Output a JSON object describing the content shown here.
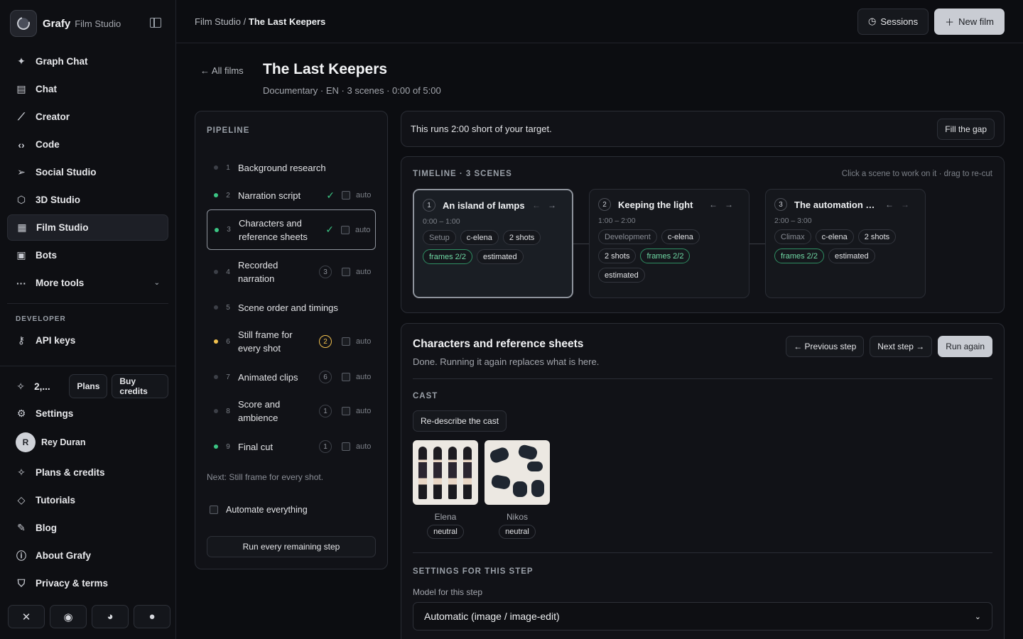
{
  "brand": {
    "name": "Grafy",
    "sub": "Film Studio"
  },
  "nav": [
    {
      "label": "Graph Chat",
      "icon": "sparkle-icon"
    },
    {
      "label": "Chat",
      "icon": "chat-icon"
    },
    {
      "label": "Creator",
      "icon": "wand-icon"
    },
    {
      "label": "Code",
      "icon": "code-icon"
    },
    {
      "label": "Social Studio",
      "icon": "send-icon"
    },
    {
      "label": "3D Studio",
      "icon": "cube-icon"
    },
    {
      "label": "Film Studio",
      "icon": "film-icon"
    },
    {
      "label": "Bots",
      "icon": "bot-icon"
    },
    {
      "label": "More tools",
      "icon": "more-icon"
    }
  ],
  "developer": {
    "label": "DEVELOPER",
    "api_keys": "API keys"
  },
  "credits": {
    "value": "2,...",
    "plans": "Plans",
    "buy": "Buy credits"
  },
  "bottom_nav": {
    "settings": "Settings",
    "user": "Rey Duran",
    "user_initial": "R",
    "plans_credits": "Plans & credits",
    "tutorials": "Tutorials",
    "blog": "Blog",
    "about": "About Grafy",
    "privacy": "Privacy & terms"
  },
  "topbar": {
    "crumb_root": "Film Studio",
    "crumb_sep": " / ",
    "crumb_current": "The Last Keepers",
    "sessions": "Sessions",
    "new_film": "New film"
  },
  "film": {
    "back": "← All films",
    "title": "The Last Keepers",
    "meta": "Documentary · EN · 3 scenes · 0:00 of 5:00"
  },
  "pipeline": {
    "label": "PIPELINE",
    "steps": [
      {
        "num": "1",
        "label": "Background research",
        "status": "none"
      },
      {
        "num": "2",
        "label": "Narration script",
        "status": "done",
        "auto": "auto"
      },
      {
        "num": "3",
        "label": "Characters and reference sheets",
        "status": "done",
        "auto": "auto"
      },
      {
        "num": "4",
        "label": "Recorded narration",
        "count": "3",
        "auto": "auto"
      },
      {
        "num": "5",
        "label": "Scene order and timings"
      },
      {
        "num": "6",
        "label": "Still frame for every shot",
        "count": "2",
        "auto": "auto"
      },
      {
        "num": "7",
        "label": "Animated clips",
        "count": "6",
        "auto": "auto"
      },
      {
        "num": "8",
        "label": "Score and ambience",
        "count": "1",
        "auto": "auto"
      },
      {
        "num": "9",
        "label": "Final cut",
        "count": "1",
        "auto": "auto"
      }
    ],
    "next_note": "Next: Still frame for every shot.",
    "automate": "Automate everything",
    "run_all": "Run every remaining step"
  },
  "alert": {
    "text": "This runs 2:00 short of your target.",
    "action": "Fill the gap"
  },
  "timeline": {
    "label": "TIMELINE · 3 SCENES",
    "hint": "Click a scene to work on it · drag to re-cut",
    "scenes": [
      {
        "num": "1",
        "title": "An island of lamps",
        "time": "0:00 – 1:00",
        "tags": [
          "Setup",
          "c-elena",
          "2 shots",
          "frames 2/2",
          "estimated"
        ]
      },
      {
        "num": "2",
        "title": "Keeping the light",
        "time": "1:00 – 2:00",
        "tags": [
          "Development",
          "c-elena",
          "2 shots",
          "frames 2/2",
          "estimated"
        ]
      },
      {
        "num": "3",
        "title": "The automation o...",
        "time": "2:00 – 3:00",
        "tags": [
          "Climax",
          "c-elena",
          "2 shots",
          "frames 2/2",
          "estimated"
        ]
      }
    ]
  },
  "detail": {
    "title": "Characters and reference sheets",
    "subtitle": "Done. Running it again replaces what is here.",
    "prev": "← Previous step",
    "next": "Next step →",
    "run_again": "Run again",
    "cast_label": "CAST",
    "redescribe": "Re-describe the cast",
    "cast": [
      {
        "name": "Elena",
        "mood": "neutral"
      },
      {
        "name": "Nikos",
        "mood": "neutral"
      }
    ],
    "settings_label": "SETTINGS FOR THIS STEP",
    "model_label": "Model for this step",
    "model_value": "Automatic (image / image-edit)"
  },
  "colors": {
    "accent_green": "#3bc483",
    "accent_amber": "#f2c14e",
    "bg": "#0c0d11"
  }
}
